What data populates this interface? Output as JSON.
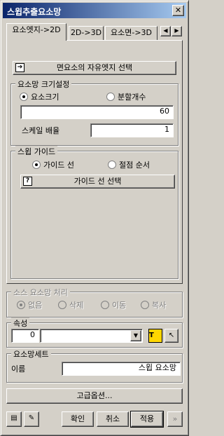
{
  "window": {
    "title": "스윕추출요소망"
  },
  "tabs": [
    {
      "label": "요소엣지->2D"
    },
    {
      "label": "2D->3D"
    },
    {
      "label": "요소면->3D"
    }
  ],
  "panel": {
    "select_free_edge_button": "면요소의 자유엣지 선택",
    "size_settings": {
      "title": "요소망 크기설정",
      "option_element_size": "요소크기",
      "option_division_count": "분할개수",
      "size_value": "60",
      "scale_label": "스케일 배율",
      "scale_value": "1"
    },
    "sweep_guide": {
      "title": "스윕 가이드",
      "option_guide_line": "가이드 선",
      "option_node_order": "절점 순서",
      "select_guide_button": "가이드 선 선택"
    }
  },
  "source_mesh": {
    "title": "소스 요소망 처리",
    "options": [
      "없음",
      "삭제",
      "이동",
      "복사"
    ]
  },
  "property": {
    "title": "속성",
    "number": "0",
    "combo_value": "",
    "button_t_label": "T"
  },
  "mesh_set": {
    "title": "요소망세트",
    "name_label": "이름",
    "name_value": "스윕 요소망"
  },
  "advanced_button": "고급옵션...",
  "footer": {
    "ok": "확인",
    "cancel": "취소",
    "apply": "적용"
  }
}
